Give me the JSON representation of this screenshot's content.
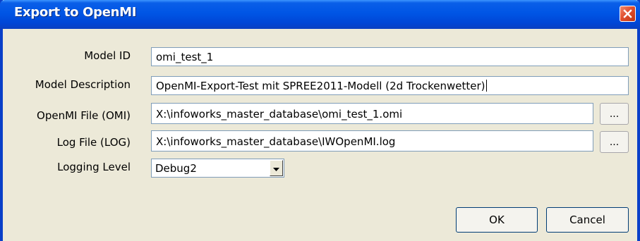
{
  "window": {
    "title": "Export to OpenMI",
    "close_icon": "close-icon"
  },
  "form": {
    "model_id": {
      "label": "Model ID",
      "value": "omi_test_1"
    },
    "model_description": {
      "label": "Model Description",
      "value": "OpenMI-Export-Test mit SPREE2011-Modell (2d Trockenwetter)"
    },
    "openmi_file": {
      "label": "OpenMI File (OMI)",
      "value": "X:\\infoworks_master_database\\omi_test_1.omi",
      "browse_label": "..."
    },
    "log_file": {
      "label": "Log File (LOG)",
      "value": "X:\\infoworks_master_database\\IWOpenMI.log",
      "browse_label": "..."
    },
    "logging_level": {
      "label": "Logging Level",
      "selected": "Debug2",
      "dropdown_icon": "chevron-down-icon"
    }
  },
  "buttons": {
    "ok": "OK",
    "cancel": "Cancel"
  },
  "colors": {
    "titlebar": "#0055e5",
    "dialog_bg": "#ece9d8",
    "field_border": "#7f9db9",
    "close": "#e0502f"
  }
}
